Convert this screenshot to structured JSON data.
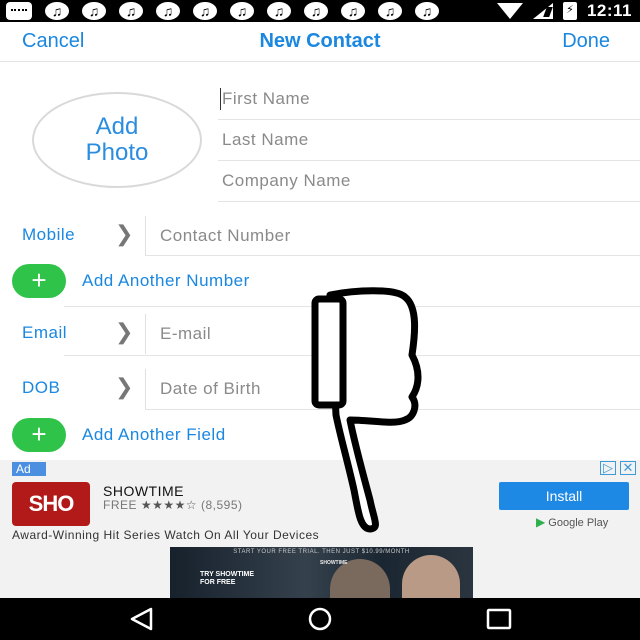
{
  "status_bar": {
    "time": "12:11",
    "icons": [
      "message-icon",
      "music-note-icon",
      "music-note-icon",
      "music-note-icon",
      "music-note-icon",
      "music-note-icon",
      "music-note-icon",
      "music-note-icon",
      "music-note-icon",
      "music-note-icon",
      "music-note-icon",
      "music-note-icon",
      "wifi-icon",
      "signal-icon",
      "battery-charging-icon"
    ]
  },
  "header": {
    "cancel_label": "Cancel",
    "title": "New Contact",
    "done_label": "Done"
  },
  "photo": {
    "line1": "Add",
    "line2": "Photo"
  },
  "name_fields": {
    "first_name_placeholder": "First Name",
    "last_name_placeholder": "Last Name",
    "company_placeholder": "Company Name"
  },
  "mobile": {
    "label": "Mobile",
    "placeholder": "Contact Number"
  },
  "add_number_label": "Add Another Number",
  "email": {
    "label": "Email",
    "placeholder": "E-mail"
  },
  "dob": {
    "label": "DOB",
    "placeholder": "Date of Birth"
  },
  "add_field_label": "Add Another Field",
  "ad": {
    "badge": "Ad",
    "logo_text": "SHO",
    "app_name": "SHOWTIME",
    "price": "FREE",
    "stars": "★★★★☆",
    "rating_count": "(8,595)",
    "rating": 4,
    "install_label": "Install",
    "store_label": "Google Play",
    "tagline": "Award-Winning Hit Series Watch On All Your Devices",
    "banner_top": "START YOUR FREE TRIAL. THEN JUST $10.99/MONTH",
    "banner_cta": "TRY SHOWTIME FOR FREE",
    "banner_brand": "SHOWTIME",
    "colors": {
      "logo_bg": "#b21a1a",
      "install_bg": "#1e88e5"
    }
  },
  "colors": {
    "accent": "#1a87e0",
    "add_button": "#2fc34a"
  },
  "nav_bar": {
    "icons": [
      "back-icon",
      "home-icon",
      "recent-apps-icon"
    ]
  }
}
